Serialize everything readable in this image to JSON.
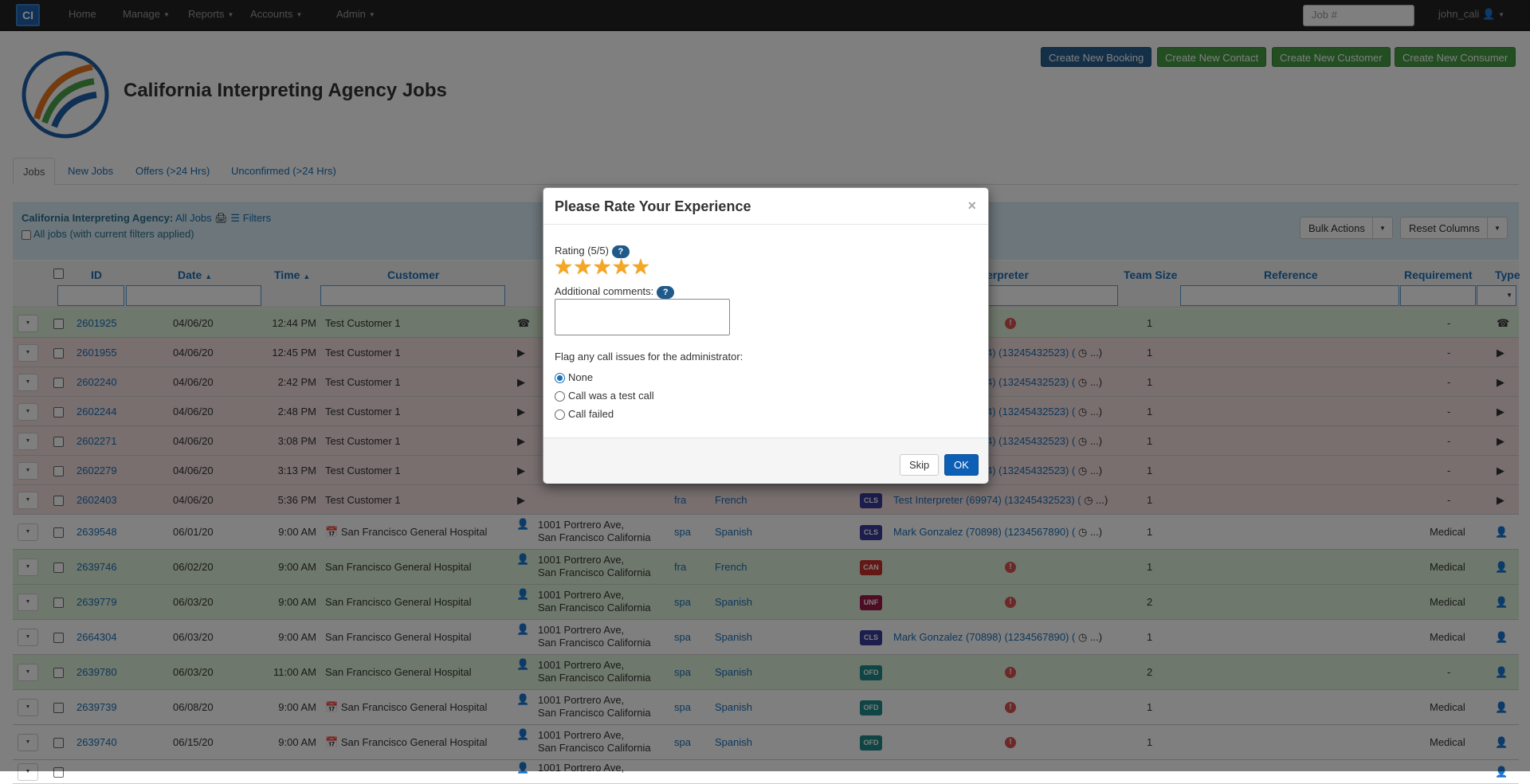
{
  "navbar": {
    "brand": "CI",
    "items": [
      {
        "label": "Home"
      },
      {
        "label": "Manage"
      },
      {
        "label": "Reports"
      },
      {
        "label": "Accounts"
      },
      {
        "label": "Admin"
      }
    ],
    "job_search_placeholder": "Job #",
    "user": "john_cali"
  },
  "header": {
    "title": "California Interpreting Agency Jobs",
    "buttons": [
      {
        "label": "Create New Booking"
      },
      {
        "label": "Create New Contact"
      },
      {
        "label": "Create New Customer"
      },
      {
        "label": "Create New Consumer"
      }
    ]
  },
  "tabs": [
    {
      "label": "Jobs"
    },
    {
      "label": "New Jobs"
    },
    {
      "label": "Offers (>24 Hrs)"
    },
    {
      "label": "Unconfirmed (>24 Hrs)"
    }
  ],
  "panel": {
    "agency": "California Interpreting Agency:",
    "scope": "All Jobs",
    "filters": "Filters",
    "all_jobs_checkbox": "All jobs (with current filters applied)",
    "bulk_actions": "Bulk Actions",
    "reset_columns": "Reset Columns"
  },
  "table": {
    "headers": {
      "id": "ID",
      "date": "Date",
      "time": "Time",
      "customer": "Customer",
      "interpreter": "erpreter",
      "team_size": "Team Size",
      "reference": "Reference",
      "requirement": "Requirement",
      "type": "Type"
    },
    "rows": [
      {
        "id": "2601925",
        "date": "04/06/20",
        "time": "12:44 PM",
        "customer": "Test Customer 1",
        "addr1": "",
        "addr2": "",
        "lang_code": "",
        "lang": "",
        "status": "",
        "interpreter": "",
        "team": "1",
        "requirement": "-"
      },
      {
        "id": "2601955",
        "date": "04/06/20",
        "time": "12:45 PM",
        "customer": "Test Customer 1",
        "addr1": "",
        "addr2": "",
        "lang_code": "",
        "lang": "",
        "status": "",
        "interpreter": "4) (13245432523) (",
        "team": "1",
        "requirement": "-"
      },
      {
        "id": "2602240",
        "date": "04/06/20",
        "time": "2:42 PM",
        "customer": "Test Customer 1",
        "addr1": "",
        "addr2": "",
        "lang_code": "",
        "lang": "",
        "status": "",
        "interpreter": "4) (13245432523) (",
        "team": "1",
        "requirement": "-"
      },
      {
        "id": "2602244",
        "date": "04/06/20",
        "time": "2:48 PM",
        "customer": "Test Customer 1",
        "addr1": "",
        "addr2": "",
        "lang_code": "",
        "lang": "",
        "status": "",
        "interpreter": "4) (13245432523) (",
        "team": "1",
        "requirement": "-"
      },
      {
        "id": "2602271",
        "date": "04/06/20",
        "time": "3:08 PM",
        "customer": "Test Customer 1",
        "addr1": "",
        "addr2": "",
        "lang_code": "",
        "lang": "",
        "status": "",
        "interpreter": "4) (13245432523) (",
        "team": "1",
        "requirement": "-"
      },
      {
        "id": "2602279",
        "date": "04/06/20",
        "time": "3:13 PM",
        "customer": "Test Customer 1",
        "addr1": "",
        "addr2": "",
        "lang_code": "",
        "lang": "",
        "status": "",
        "interpreter": "4) (13245432523) (",
        "team": "1",
        "requirement": "-"
      },
      {
        "id": "2602403",
        "date": "04/06/20",
        "time": "5:36 PM",
        "customer": "Test Customer 1",
        "addr1": "",
        "addr2": "",
        "lang_code": "fra",
        "lang": "French",
        "status": "CLS",
        "interpreter": "Test Interpreter (69974) (13245432523) (",
        "team": "1",
        "requirement": "-"
      },
      {
        "id": "2639548",
        "date": "06/01/20",
        "time": "9:00 AM",
        "customer": "San Francisco General Hospital",
        "addr1": "1001 Portrero Ave,",
        "addr2": "San Francisco California",
        "lang_code": "spa",
        "lang": "Spanish",
        "status": "CLS",
        "interpreter": "Mark Gonzalez (70898) (1234567890) (",
        "team": "1",
        "requirement": "Medical"
      },
      {
        "id": "2639746",
        "date": "06/02/20",
        "time": "9:00 AM",
        "customer": "San Francisco General Hospital",
        "addr1": "1001 Portrero Ave,",
        "addr2": "San Francisco California",
        "lang_code": "fra",
        "lang": "French",
        "status": "CAN",
        "interpreter": "",
        "team": "1",
        "requirement": "Medical"
      },
      {
        "id": "2639779",
        "date": "06/03/20",
        "time": "9:00 AM",
        "customer": "San Francisco General Hospital",
        "addr1": "1001 Portrero Ave,",
        "addr2": "San Francisco California",
        "lang_code": "spa",
        "lang": "Spanish",
        "status": "UNF",
        "interpreter": "",
        "team": "2",
        "requirement": "Medical"
      },
      {
        "id": "2664304",
        "date": "06/03/20",
        "time": "9:00 AM",
        "customer": "San Francisco General Hospital",
        "addr1": "1001 Portrero Ave,",
        "addr2": "San Francisco California",
        "lang_code": "spa",
        "lang": "Spanish",
        "status": "CLS",
        "interpreter": "Mark Gonzalez (70898) (1234567890) (",
        "team": "1",
        "requirement": "Medical"
      },
      {
        "id": "2639780",
        "date": "06/03/20",
        "time": "11:00 AM",
        "customer": "San Francisco General Hospital",
        "addr1": "1001 Portrero Ave,",
        "addr2": "San Francisco California",
        "lang_code": "spa",
        "lang": "Spanish",
        "status": "OFD",
        "interpreter": "",
        "team": "2",
        "requirement": "-"
      },
      {
        "id": "2639739",
        "date": "06/08/20",
        "time": "9:00 AM",
        "customer": "San Francisco General Hospital",
        "addr1": "1001 Portrero Ave,",
        "addr2": "San Francisco California",
        "lang_code": "spa",
        "lang": "Spanish",
        "status": "OFD",
        "interpreter": "",
        "team": "1",
        "requirement": "Medical"
      },
      {
        "id": "2639740",
        "date": "06/15/20",
        "time": "9:00 AM",
        "customer": "San Francisco General Hospital",
        "addr1": "1001 Portrero Ave,",
        "addr2": "San Francisco California",
        "lang_code": "spa",
        "lang": "Spanish",
        "status": "OFD",
        "interpreter": "",
        "team": "1",
        "requirement": "Medical"
      },
      {
        "id": "",
        "date": "",
        "time": "",
        "customer": "",
        "addr1": "1001 Portrero Ave,",
        "addr2": "",
        "lang_code": "",
        "lang": "",
        "status": "",
        "interpreter": "",
        "team": "",
        "requirement": ""
      }
    ]
  },
  "modal": {
    "title": "Please Rate Your Experience",
    "close": "×",
    "rating_label": "Rating (5/5)",
    "rating_value": 5,
    "rating_max": 5,
    "help": "?",
    "comments_label": "Additional comments:",
    "comments_value": "",
    "flag_label": "Flag any call issues for the administrator:",
    "options": [
      {
        "label": "None",
        "checked": true
      },
      {
        "label": "Call was a test call",
        "checked": false
      },
      {
        "label": "Call failed",
        "checked": false
      }
    ],
    "skip": "Skip",
    "ok": "OK"
  },
  "colors": {
    "row_green": "#dff0d8",
    "row_red": "#f2dede",
    "status_cls": "#3a3a9c",
    "status_can": "#c9302c",
    "status_unf": "#9c1a4a",
    "status_ofd": "#1f8a8a",
    "ok_button": "#0d5fb5",
    "star": "#f5a623"
  }
}
